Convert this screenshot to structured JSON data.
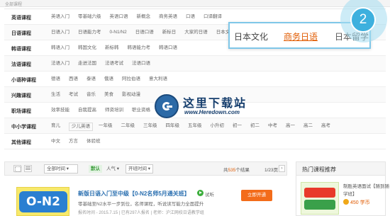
{
  "header": {
    "title": "全部课程"
  },
  "categories": [
    {
      "label": "英语课程",
      "items": [
        "英语入门",
        "零基础六级",
        "英语口语",
        "新概念",
        "商务英语",
        "口语",
        "口译翻译"
      ],
      "boxed": []
    },
    {
      "label": "日语课程",
      "items": [
        "日语入门",
        "日语能力考",
        "0-N1/N2",
        "日语口语",
        "新标日",
        "大家的日语",
        "日本文化",
        "商务日语"
      ],
      "boxed": []
    },
    {
      "label": "韩语课程",
      "items": [
        "韩语入门",
        "韩国文化",
        "新标韩",
        "韩语能力考",
        "韩语口语"
      ],
      "boxed": []
    },
    {
      "label": "法语课程",
      "items": [
        "法语入门",
        "走进法国",
        "法语考试",
        "法语口语"
      ],
      "boxed": []
    },
    {
      "label": "小语种课程",
      "items": [
        "德语",
        "西语",
        "泰语",
        "俄语",
        "阿拉伯语",
        "意大利语"
      ],
      "boxed": []
    },
    {
      "label": "兴趣课程",
      "items": [
        "生活",
        "考试",
        "音乐",
        "美食",
        "影视动漫"
      ],
      "boxed": []
    },
    {
      "label": "职场课程",
      "items": [
        "效率技能",
        "自我提高",
        "师资培训",
        "职业资格"
      ],
      "boxed": []
    },
    {
      "label": "中小学课程",
      "items": [
        "育儿",
        "少儿英语",
        "一年级",
        "二年级",
        "三年级",
        "四年级",
        "五年级",
        "小升初",
        "初一",
        "初二",
        "中考",
        "高一",
        "高二",
        "高考"
      ],
      "boxed": [
        "少儿英语"
      ]
    },
    {
      "label": "其他课程",
      "items": [
        "中文",
        "方言",
        "体验班"
      ],
      "boxed": []
    }
  ],
  "tag_popup": {
    "tags": [
      "日本文化",
      "商务日语",
      "日本留学"
    ],
    "active_index": 1
  },
  "step_badge": "2",
  "watermark": {
    "name": "这里下载站",
    "url": "www.Heredown.com"
  },
  "toolbar": {
    "time_select": "全部时间",
    "sort_options": [
      "默认",
      "人气",
      "开班时间"
    ],
    "count_prefix": "共",
    "count_value": "535",
    "count_suffix": "个结果",
    "page": "1/23页",
    "next": "›"
  },
  "course": {
    "thumb_text": "O-N2",
    "title": "新版日语入门至中级【0-N2名师5月通关班】",
    "trial": "试听",
    "desc": "零基础至N2水平一步到位，名师课程，听说读写能力全面提升",
    "meta": "报名时间 - 2015.7.15 | 已有297人报名 | 老师：沪江网校日语教学组",
    "buy_label": "立即开通"
  },
  "hot": {
    "header": "热门课程推荐",
    "item_name": "制胜英语面试【随到随",
    "item_name2": "学班】",
    "price": "450 学币"
  },
  "colors": {
    "accent": "#3db0de",
    "highlight": "#e05a00",
    "link": "#2a6fb0",
    "buy": "#f36c1a"
  }
}
